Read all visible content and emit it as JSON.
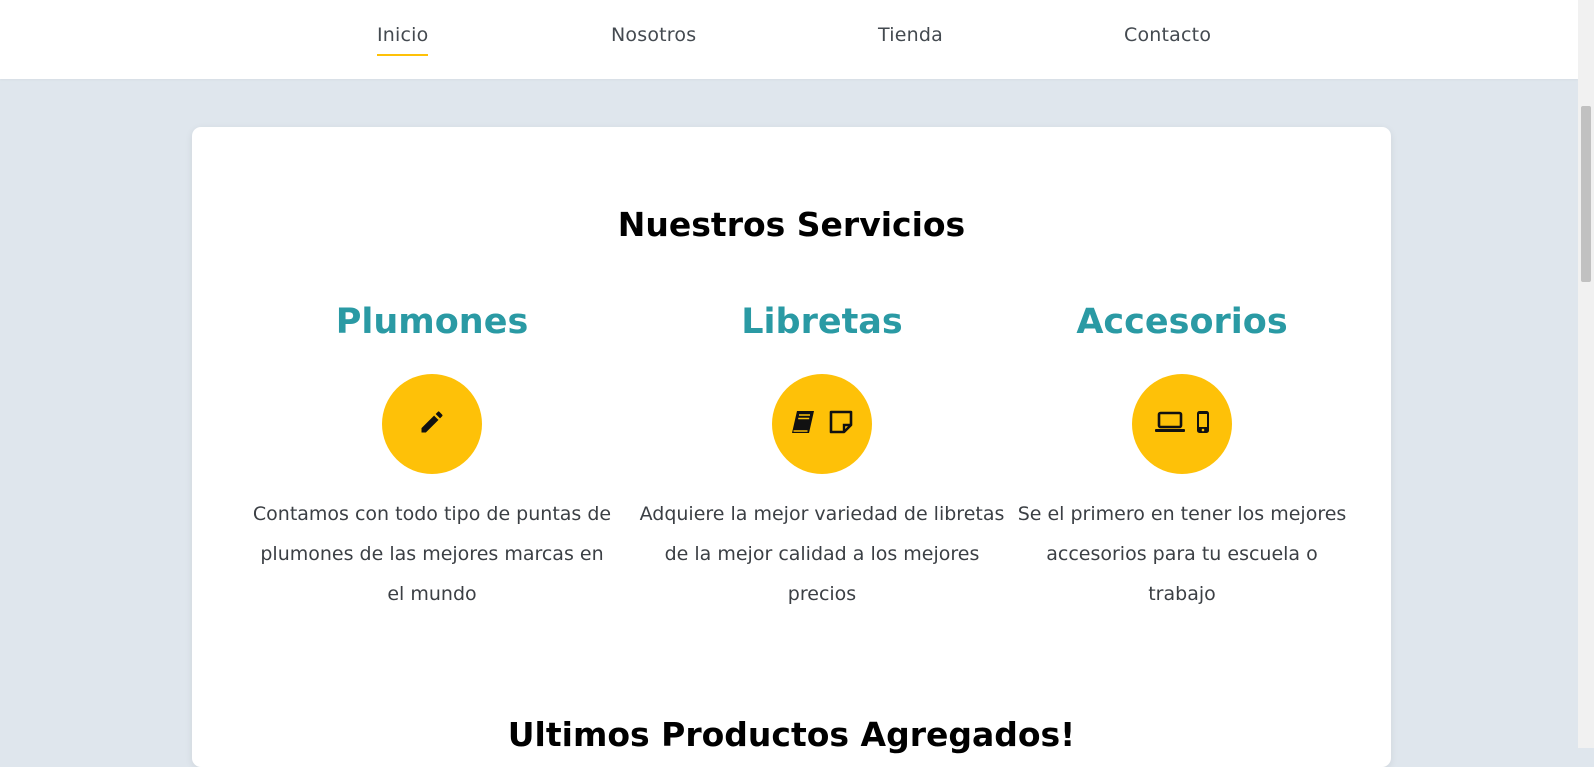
{
  "nav": {
    "items": [
      {
        "label": "Inicio",
        "active": true
      },
      {
        "label": "Nosotros",
        "active": false
      },
      {
        "label": "Tienda",
        "active": false
      },
      {
        "label": "Contacto",
        "active": false
      }
    ]
  },
  "services": {
    "title": "Nuestros Servicios",
    "items": [
      {
        "name": "Plumones",
        "icons": [
          "pencil-icon"
        ],
        "description": "Contamos con todo tipo de puntas de plumones de las mejores marcas en el mundo"
      },
      {
        "name": "Libretas",
        "icons": [
          "book-icon",
          "sticky-note-icon"
        ],
        "description": "Adquiere la mejor variedad de libretas de la mejor calidad a los mejores precios"
      },
      {
        "name": "Accesorios",
        "icons": [
          "laptop-icon",
          "mobile-phone-icon"
        ],
        "description": "Se el primero en tener los mejores accesorios para tu escuela o trabajo"
      }
    ]
  },
  "latest_products": {
    "title": "Ultimos Productos Agregados!"
  },
  "colors": {
    "accent": "#fec108",
    "service_title": "#2a9aa4",
    "page_background": "#dfe6ed"
  }
}
